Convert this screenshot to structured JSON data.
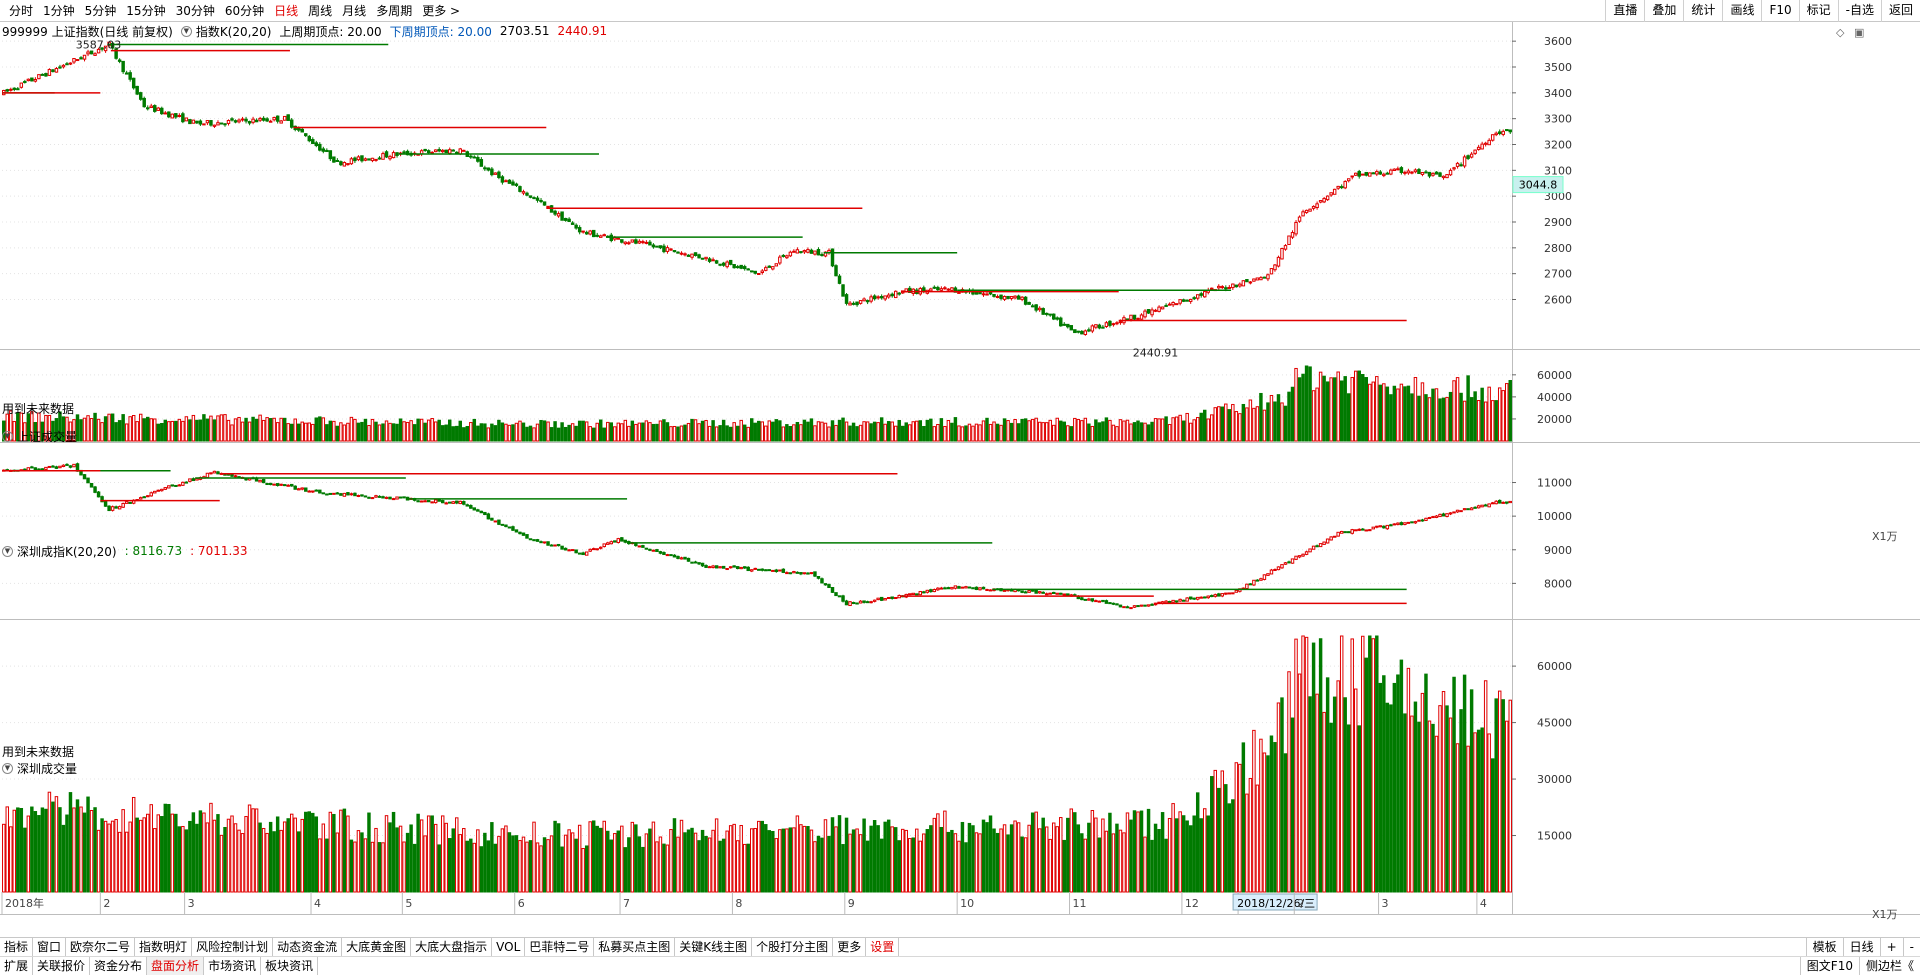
{
  "toolbar": {
    "periods": [
      "分时",
      "1分钟",
      "5分钟",
      "15分钟",
      "30分钟",
      "60分钟",
      "日线",
      "周线",
      "月线",
      "多周期",
      "更多 >"
    ],
    "active_period": "日线",
    "tools": [
      "直播",
      "叠加",
      "统计",
      "画线",
      "F10",
      "标记",
      "-自选",
      "返回"
    ]
  },
  "main_panel": {
    "code_name": "999999 上证指数(日线 前复权)",
    "indicator": "指数K(20,20)",
    "prev_week_label": "上周期顶点: 20.00",
    "next_week_label": "下周期顶点: 20.00",
    "val1": "2703.51",
    "val2": "2440.91",
    "high_label": "3587.03",
    "low_label": "2440.91",
    "price_tag": "3044.8",
    "future_note": "用到未来数据"
  },
  "vol1_panel": {
    "title": "上证成交量",
    "unit": "X1万"
  },
  "sz_panel": {
    "title": "深圳成指K(20,20)",
    "val1": ": 8116.73",
    "val2": ": 7011.33",
    "future_note": "用到未来数据"
  },
  "vol2_panel": {
    "title": "深圳成交量",
    "unit": "X1万",
    "cursor_date": "2018/12/26/三"
  },
  "bottom_tabs_1": [
    "指标",
    "窗口",
    "欧奈尔二号",
    "指数明灯",
    "风险控制计划",
    "动态资金流",
    "大底黄金图",
    "大底大盘指示",
    "VOL",
    "巴菲特二号",
    "私募买点主图",
    "关键K线主图",
    "个股打分主图",
    "更多",
    "设置"
  ],
  "bottom_tabs_2": [
    "扩展",
    "关联报价",
    "资金分布",
    "盘面分析",
    "市场资讯",
    "板块资讯"
  ],
  "active_tab_2": "盘面分析",
  "right_controls_1": [
    "模板",
    "日线",
    "+",
    "-"
  ],
  "right_controls_2": [
    "图文F10",
    "侧边栏《"
  ],
  "colors": {
    "up": "#e00000",
    "down": "#007a00",
    "grid": "#e4e4e4"
  },
  "chart_data": [
    {
      "type": "candlestick",
      "title": "999999 上证指数(日线 前复权)",
      "x_ticks": [
        "2018年",
        "2",
        "3",
        "4",
        "5",
        "6",
        "7",
        "8",
        "9",
        "10",
        "11",
        "12",
        "2018/12/26/三",
        "2",
        "3",
        "4"
      ],
      "y_ticks": [
        2600,
        2700,
        2800,
        2900,
        3000,
        3100,
        3200,
        3300,
        3400,
        3500,
        3600
      ],
      "ylim": [
        2420,
        3620
      ],
      "start": 3350,
      "high": 3587.03,
      "low": 2440.91,
      "last": 3044.8,
      "trend": [
        [
          0,
          3400
        ],
        [
          30,
          3587
        ],
        [
          40,
          3350
        ],
        [
          55,
          3280
        ],
        [
          80,
          3300
        ],
        [
          95,
          3130
        ],
        [
          110,
          3160
        ],
        [
          130,
          3180
        ],
        [
          140,
          3080
        ],
        [
          150,
          3000
        ],
        [
          165,
          2860
        ],
        [
          180,
          2820
        ],
        [
          200,
          2760
        ],
        [
          215,
          2700
        ],
        [
          225,
          2790
        ],
        [
          235,
          2780
        ],
        [
          240,
          2580
        ],
        [
          255,
          2630
        ],
        [
          270,
          2640
        ],
        [
          290,
          2600
        ],
        [
          305,
          2470
        ],
        [
          325,
          2545
        ],
        [
          345,
          2640
        ],
        [
          360,
          2690
        ],
        [
          370,
          2940
        ],
        [
          385,
          3080
        ],
        [
          400,
          3100
        ],
        [
          410,
          3070
        ],
        [
          425,
          3250
        ]
      ]
    },
    {
      "type": "bar",
      "title": "上证成交量",
      "y_ticks": [
        20000,
        40000,
        60000
      ],
      "ylim": [
        0,
        68000
      ],
      "trend": [
        [
          0,
          22000
        ],
        [
          50,
          20000
        ],
        [
          150,
          15000
        ],
        [
          250,
          17000
        ],
        [
          330,
          17000
        ],
        [
          350,
          28000
        ],
        [
          365,
          42000
        ],
        [
          370,
          60000
        ],
        [
          390,
          55000
        ],
        [
          425,
          45000
        ]
      ]
    },
    {
      "type": "candlestick",
      "title": "深圳成指K(20,20)",
      "y_ticks": [
        8000,
        9000,
        10000,
        11000
      ],
      "ylim": [
        7000,
        11700
      ],
      "start": 11300,
      "high": 11500,
      "low": 7011.33,
      "last": 10400,
      "trend": [
        [
          0,
          11350
        ],
        [
          20,
          11500
        ],
        [
          30,
          10200
        ],
        [
          45,
          10800
        ],
        [
          60,
          11300
        ],
        [
          90,
          10700
        ],
        [
          130,
          10400
        ],
        [
          150,
          9300
        ],
        [
          165,
          8900
        ],
        [
          175,
          9300
        ],
        [
          200,
          8500
        ],
        [
          230,
          8300
        ],
        [
          240,
          7400
        ],
        [
          255,
          7600
        ],
        [
          270,
          7900
        ],
        [
          300,
          7700
        ],
        [
          320,
          7300
        ],
        [
          335,
          7500
        ],
        [
          350,
          7700
        ],
        [
          365,
          8600
        ],
        [
          380,
          9500
        ],
        [
          400,
          9800
        ],
        [
          425,
          10400
        ]
      ]
    },
    {
      "type": "bar",
      "title": "深圳成交量",
      "y_ticks": [
        15000,
        30000,
        45000,
        60000
      ],
      "ylim": [
        0,
        68000
      ],
      "trend": [
        [
          0,
          22000
        ],
        [
          50,
          20000
        ],
        [
          150,
          15000
        ],
        [
          250,
          17000
        ],
        [
          330,
          18000
        ],
        [
          350,
          30000
        ],
        [
          365,
          45000
        ],
        [
          370,
          60000
        ],
        [
          390,
          56000
        ],
        [
          425,
          45000
        ]
      ]
    }
  ]
}
